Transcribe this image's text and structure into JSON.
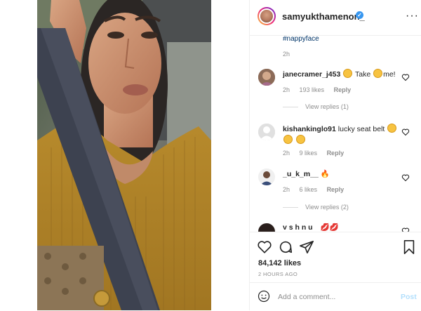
{
  "header": {
    "username": "samyukthamenon_",
    "verified_mark": "✓",
    "more_glyph": "···"
  },
  "caption_tail": {
    "hashtag": "#nappyface",
    "time": "2h"
  },
  "comments": [
    {
      "username": "janecramer_j453",
      "text_parts": [
        "Take",
        "me!"
      ],
      "time": "2h",
      "likes": "193 likes",
      "reply": "Reply",
      "view_replies": "View replies (1)"
    },
    {
      "username": "kishankinglo91",
      "text": "lucky seat belt",
      "time": "2h",
      "likes": "9 likes",
      "reply": "Reply"
    },
    {
      "username": "_u_k_m__",
      "time": "2h",
      "likes": "6 likes",
      "reply": "Reply",
      "view_replies": "View replies (2)"
    },
    {
      "username": "v s h n u"
    }
  ],
  "actions": {
    "likes": "84,142 likes",
    "timestamp": "2 HOURS AGO"
  },
  "add_comment": {
    "placeholder": "Add a comment...",
    "post_label": "Post"
  },
  "colors": {
    "link": "#003569",
    "verified": "#3897f0",
    "post_disabled": "#b2dffc",
    "meta": "#8e8e8e"
  }
}
